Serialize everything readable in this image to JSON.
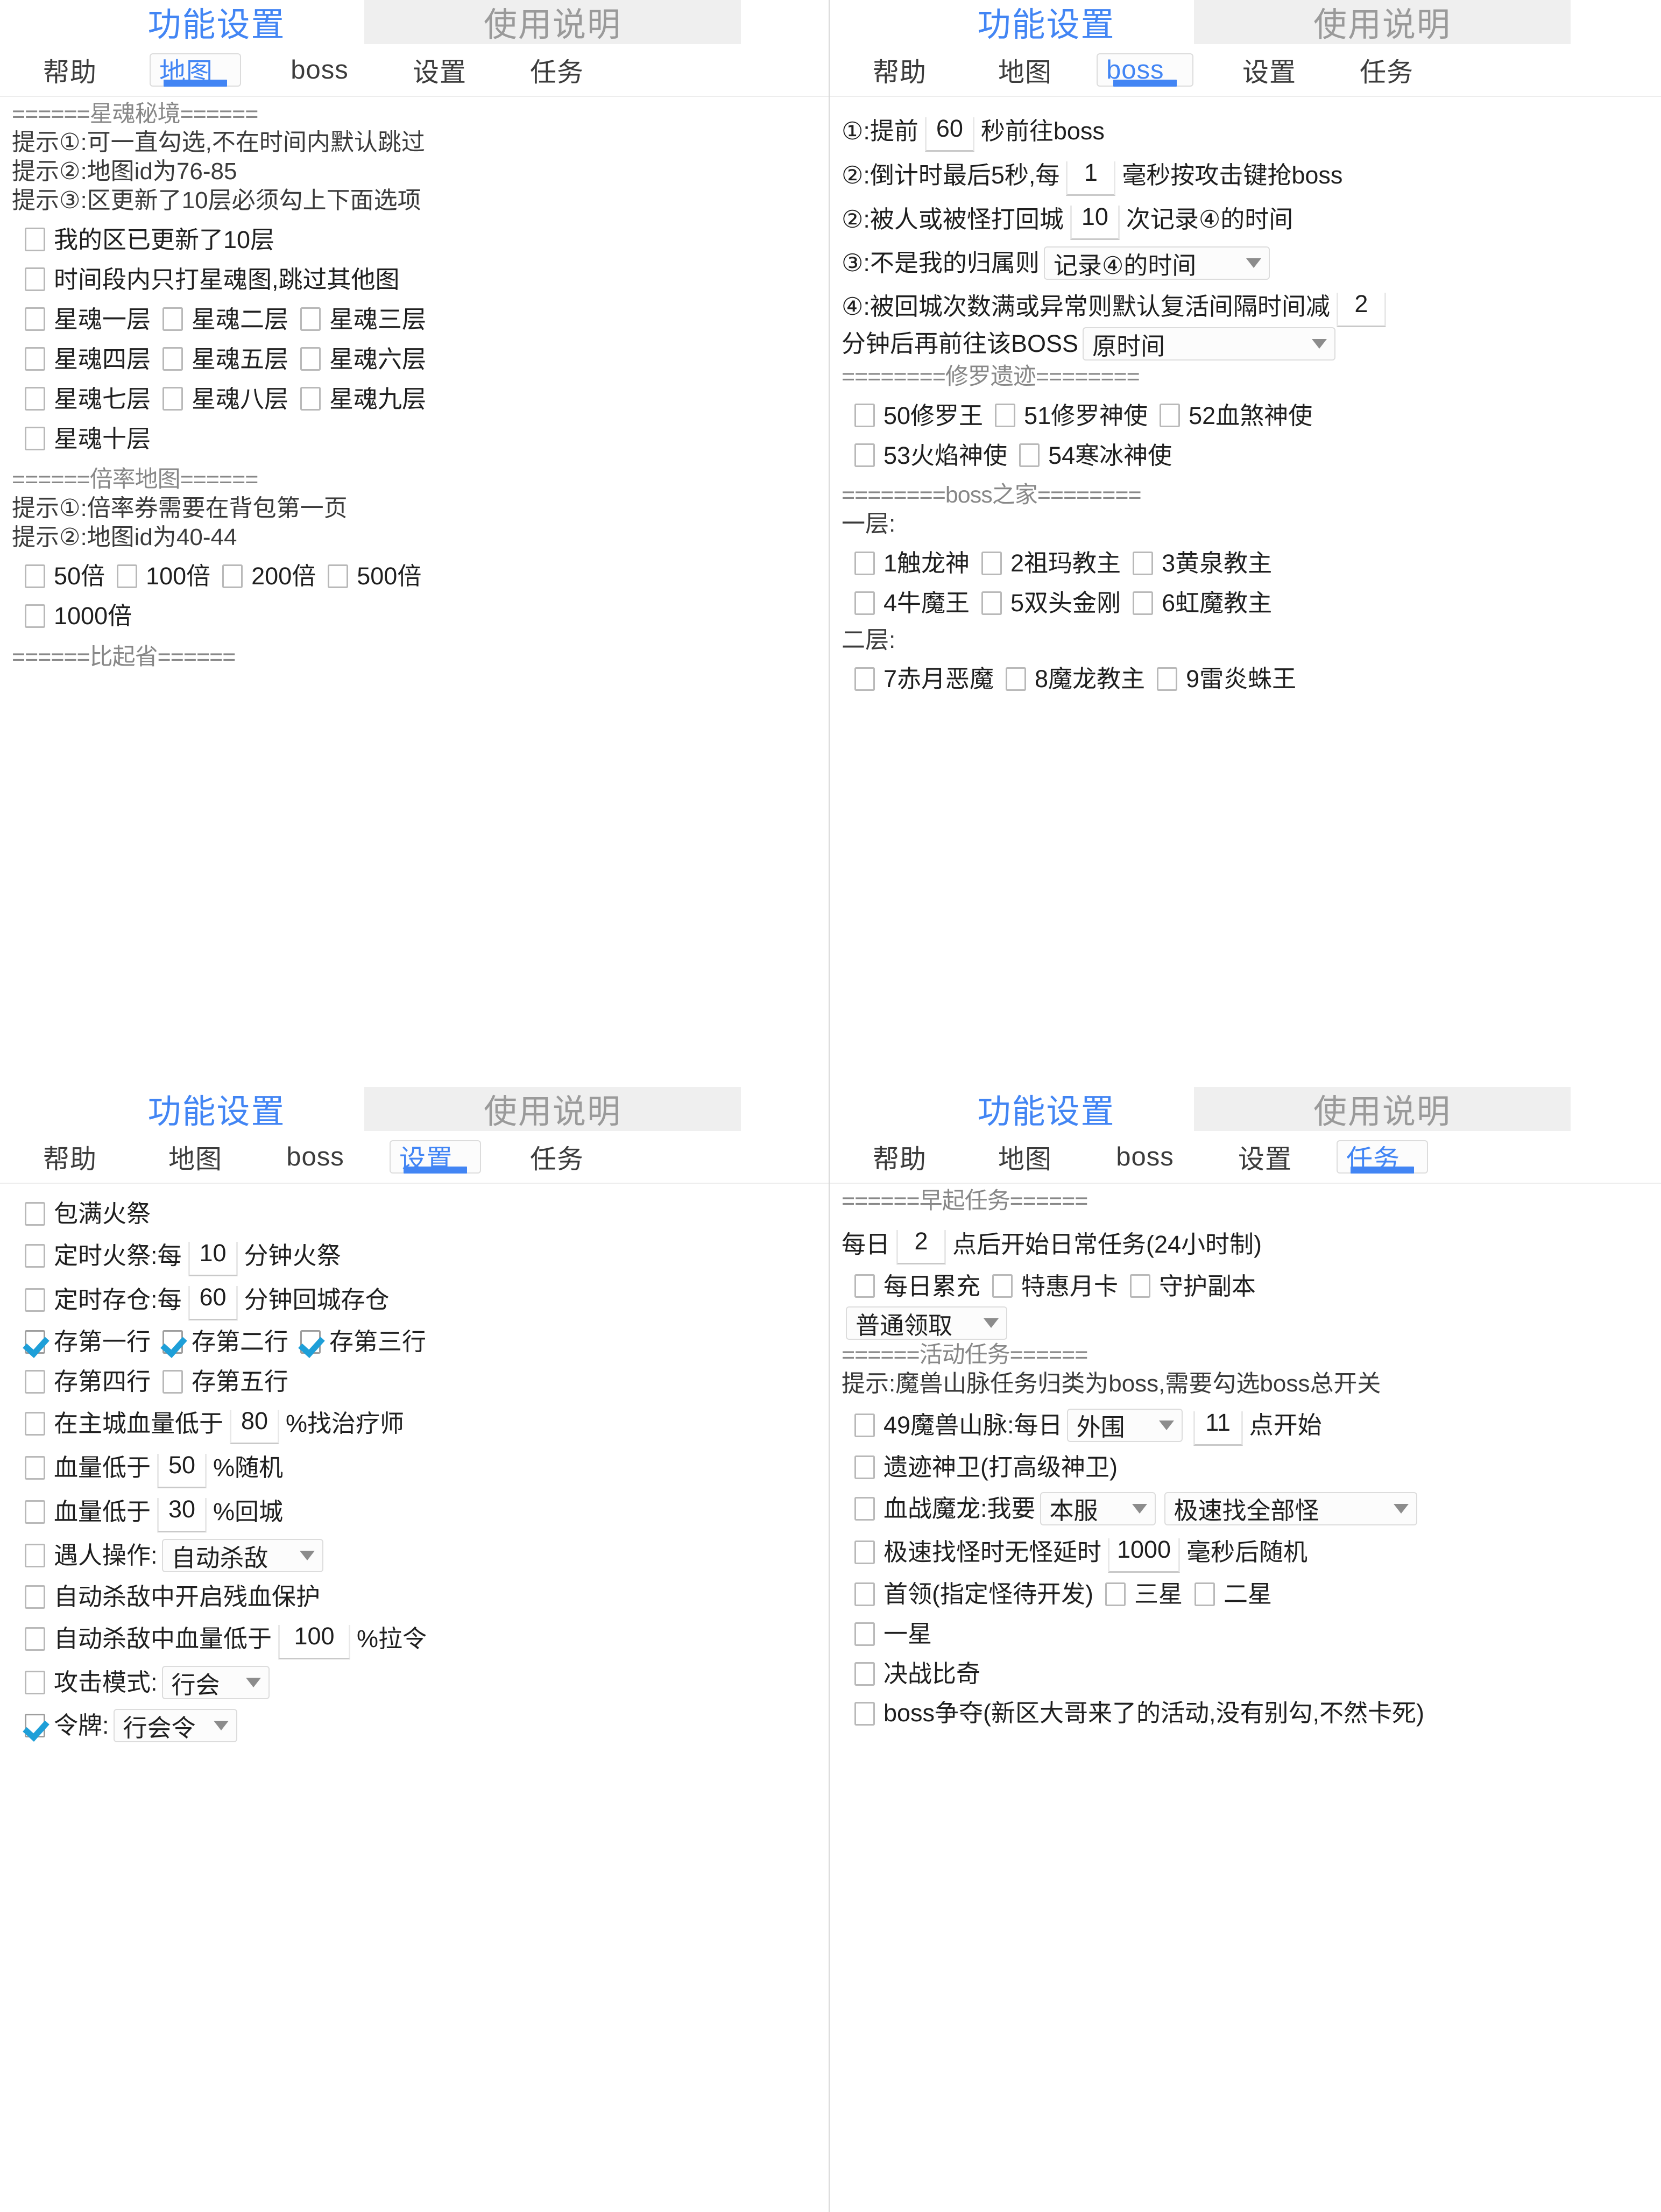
{
  "window": {
    "active_tab": "功能设置",
    "inactive_tab": "使用说明",
    "accent": "#4285f4",
    "check_color": "#1e9fd8"
  },
  "nav_tabs": [
    "帮助",
    "地图",
    "boss",
    "设置",
    "任务"
  ],
  "panels": {
    "map": {
      "selected_tab": "地图",
      "section1_header": "======星魂秘境======",
      "tips": [
        "提示①:可一直勾选,不在时间内默认跳过",
        "提示②:地图id为76-85",
        "提示③:区更新了10层必须勾上下面选项"
      ],
      "check_updated10": "我的区已更新了10层",
      "check_only_star": "时间段内只打星魂图,跳过其他图",
      "floors": [
        "星魂一层",
        "星魂二层",
        "星魂三层",
        "星魂四层",
        "星魂五层",
        "星魂六层",
        "星魂七层",
        "星魂八层",
        "星魂九层",
        "星魂十层"
      ],
      "section2_header": "======倍率地图======",
      "tips2": [
        "提示①:倍率券需要在背包第一页",
        "提示②:地图id为40-44"
      ],
      "rates": [
        "50倍",
        "100倍",
        "200倍",
        "500倍",
        "1000倍"
      ],
      "section3_header": "======比起省======"
    },
    "boss": {
      "selected_tab": "boss",
      "line1_pre": "①:提前",
      "line1_value": "60",
      "line1_post": "秒前往boss",
      "line2_pre": "②:倒计时最后5秒,每",
      "line2_value": "1",
      "line2_post": "毫秒按攻击键抢boss",
      "line3_pre": "②:被人或被怪打回城",
      "line3_value": "10",
      "line3_post": "次记录④的时间",
      "line4_pre": "③:不是我的归属则",
      "line4_select": "记录④的时间",
      "line5_pre": "④:被回城次数满或异常则默认复活间隔时间减",
      "line5_value": "2",
      "line6_pre": "分钟后再前往该BOSS",
      "line6_select": "原时间",
      "section_xiuluo": "========修罗遗迹========",
      "xiuluo_bosses": [
        "50修罗王",
        "51修罗神使",
        "52血煞神使",
        "53火焰神使",
        "54寒冰神使"
      ],
      "section_bosshome": "========boss之家========",
      "floor1_label": "一层:",
      "floor1_bosses": [
        "1触龙神",
        "2祖玛教主",
        "3黄泉教主",
        "4牛魔王",
        "5双头金刚",
        "6虹魔教主"
      ],
      "floor2_label": "二层:",
      "floor2_bosses": [
        "7赤月恶魔",
        "8魔龙教主",
        "9雷炎蛛王"
      ]
    },
    "settings": {
      "selected_tab": "设置",
      "bag_full_fire": "包满火祭",
      "timed_fire_pre": "定时火祭:每",
      "timed_fire_value": "10",
      "timed_fire_post": "分钟火祭",
      "timed_store_pre": "定时存仓:每",
      "timed_store_value": "60",
      "timed_store_post": "分钟回城存仓",
      "store_rows": [
        "存第一行",
        "存第二行",
        "存第三行",
        "存第四行",
        "存第五行"
      ],
      "store_rows_checked": [
        true,
        true,
        true,
        false,
        false
      ],
      "heal_pre": "在主城血量低于",
      "heal_value": "80",
      "heal_post": "%找治疗师",
      "rand_pre": "血量低于",
      "rand_value": "50",
      "rand_post": "%随机",
      "town_pre": "血量低于",
      "town_value": "30",
      "town_post": "%回城",
      "meet_pre": "遇人操作:",
      "meet_select": "自动杀敌",
      "lowhp_protect": "自动杀敌中开启残血保护",
      "autokill_pre": "自动杀敌中血量低于",
      "autokill_value": "100",
      "autokill_post": "%拉令",
      "attack_mode_pre": "攻击模式:",
      "attack_mode_select": "行会",
      "token_pre": "令牌:",
      "token_select": "行会令",
      "token_checked": true
    },
    "quests": {
      "selected_tab": "任务",
      "section_early": "======早起任务======",
      "daily_pre": "每日",
      "daily_value": "2",
      "daily_post": "点后开始日常任务(24小时制)",
      "daily_checks": [
        "每日累充",
        "特惠月卡",
        "守护副本"
      ],
      "claim_select": "普通领取",
      "section_activity": "======活动任务======",
      "activity_tip": "提示:魔兽山脉任务归类为boss,需要勾选boss总开关",
      "mountain_pre": "49魔兽山脉:每日",
      "mountain_select": "外围",
      "mountain_value": "11",
      "mountain_post": "点开始",
      "relic_guard": "遗迹神卫(打高级神卫)",
      "dragon_pre": "血战魔龙:我要",
      "dragon_select1": "本服",
      "dragon_select2": "极速找全部怪",
      "fast_pre": "极速找怪时无怪延时",
      "fast_value": "1000",
      "fast_post": "毫秒后随机",
      "leader": "首领(指定怪待开发)",
      "leader_stars": [
        "三星",
        "二星"
      ],
      "one_star": "一星",
      "final_battle": "决战比奇",
      "boss_fight": "boss争夺(新区大哥来了的活动,没有别勾,不然卡死)"
    }
  }
}
